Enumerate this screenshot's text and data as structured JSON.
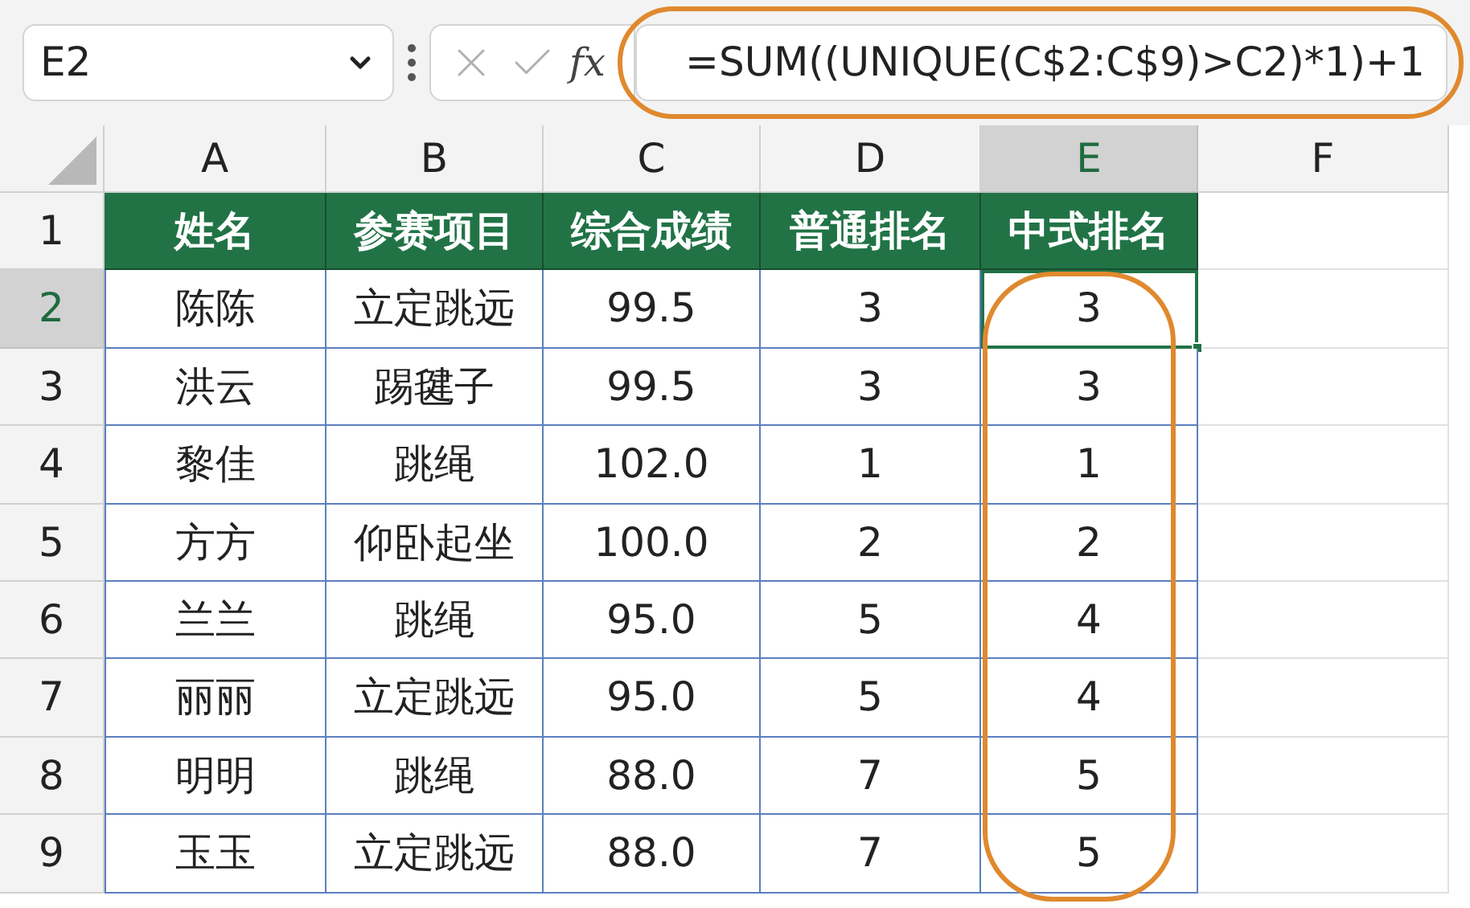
{
  "name_box": {
    "value": "E2"
  },
  "formula_bar": {
    "fx": "fx",
    "value": "=SUM((UNIQUE(C$2:C$9)>C2)*1)+1"
  },
  "grid": {
    "columns": [
      {
        "label": "A",
        "selected": false
      },
      {
        "label": "B",
        "selected": false
      },
      {
        "label": "C",
        "selected": false
      },
      {
        "label": "D",
        "selected": false
      },
      {
        "label": "E",
        "selected": true
      },
      {
        "label": "F",
        "selected": false
      }
    ],
    "rows": [
      {
        "label": "1",
        "kind": "header",
        "selected": false,
        "cells": [
          "姓名",
          "参赛项目",
          "综合成绩",
          "普通排名",
          "中式排名"
        ]
      },
      {
        "label": "2",
        "kind": "data",
        "selected": true,
        "cells": [
          "陈陈",
          "立定跳远",
          "99.5",
          "3",
          "3"
        ]
      },
      {
        "label": "3",
        "kind": "data",
        "selected": false,
        "cells": [
          "洪云",
          "踢毽子",
          "99.5",
          "3",
          "3"
        ]
      },
      {
        "label": "4",
        "kind": "data",
        "selected": false,
        "cells": [
          "黎佳",
          "跳绳",
          "102.0",
          "1",
          "1"
        ]
      },
      {
        "label": "5",
        "kind": "data",
        "selected": false,
        "cells": [
          "方方",
          "仰卧起坐",
          "100.0",
          "2",
          "2"
        ]
      },
      {
        "label": "6",
        "kind": "data",
        "selected": false,
        "cells": [
          "兰兰",
          "跳绳",
          "95.0",
          "5",
          "4"
        ]
      },
      {
        "label": "7",
        "kind": "data",
        "selected": false,
        "cells": [
          "丽丽",
          "立定跳远",
          "95.0",
          "5",
          "4"
        ]
      },
      {
        "label": "8",
        "kind": "data",
        "selected": false,
        "cells": [
          "明明",
          "跳绳",
          "88.0",
          "7",
          "5"
        ]
      },
      {
        "label": "9",
        "kind": "data",
        "selected": false,
        "cells": [
          "玉玉",
          "立定跳远",
          "88.0",
          "7",
          "5"
        ]
      }
    ]
  }
}
